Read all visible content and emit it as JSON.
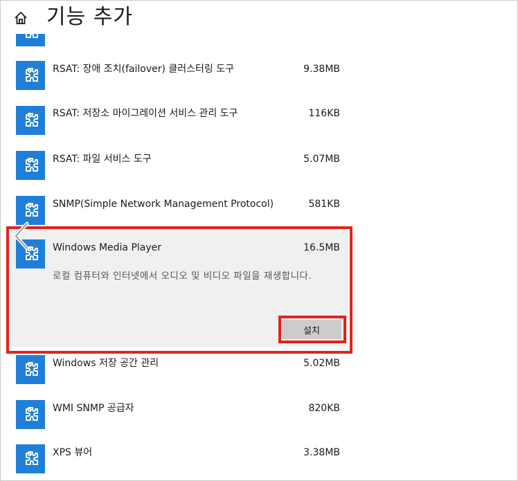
{
  "header": {
    "title": "기능 추가"
  },
  "features": [
    {
      "name": "RSAT: 장애 조치(failover) 클러스터링 도구",
      "size": "9.38MB"
    },
    {
      "name": "RSAT: 저장소 마이그레이션 서비스 관리 도구",
      "size": "116KB"
    },
    {
      "name": "RSAT: 파일 서비스 도구",
      "size": "5.07MB"
    },
    {
      "name": "SNMP(Simple Network Management Protocol)",
      "size": "581KB"
    }
  ],
  "selected": {
    "name": "Windows Media Player",
    "size": "16.5MB",
    "description": "로컬 컴퓨터와 인터넷에서 오디오 및 비디오 파일을 재생합니다.",
    "install_label": "설치"
  },
  "features_after": [
    {
      "name": "Windows 저장 공간 관리",
      "size": "5.02MB"
    },
    {
      "name": "WMI SNMP 공급자",
      "size": "820KB"
    },
    {
      "name": "XPS 뷰어",
      "size": "3.38MB"
    }
  ],
  "colors": {
    "tile": "#1f7fd8",
    "highlight": "#e2231a",
    "expanded_bg": "#f0f0f0",
    "button_bg": "#cccccc"
  },
  "icons": {
    "home": "home-icon",
    "feature": "puzzle-gear-icon",
    "back": "chevron-left-icon"
  }
}
